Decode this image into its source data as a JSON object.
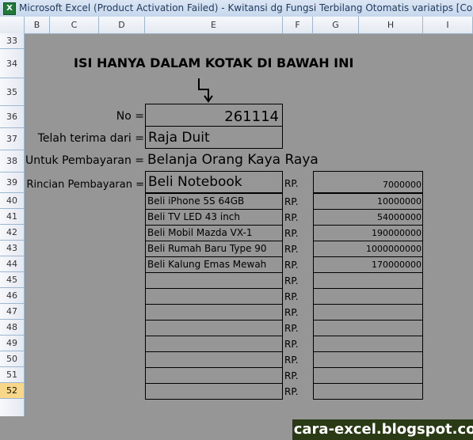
{
  "window": {
    "title": "Microsoft Excel (Product Activation Failed) - Kwitansi dg Fungsi Terbilang Otomatis variatips  [Compatibility",
    "app_icon": "excel-icon"
  },
  "columns": [
    "B",
    "C",
    "D",
    "E",
    "F",
    "G",
    "H",
    "I"
  ],
  "rows": [
    "33",
    "34",
    "35",
    "36",
    "37",
    "38",
    "39",
    "40",
    "41",
    "42",
    "43",
    "44",
    "45",
    "46",
    "47",
    "48",
    "49",
    "50",
    "51",
    "52"
  ],
  "active_row": "52",
  "form": {
    "heading": "ISI HANYA DALAM KOTAK DI BAWAH INI",
    "no_label": "No =",
    "no_value": "261114",
    "received_label": "Telah terima dari =",
    "received_value": "Raja Duit",
    "purpose_label": "Untuk Pembayaran =",
    "purpose_value": "Belanja Orang Kaya Raya",
    "details_label": "Rincian Pembayaran =",
    "details_title": "Beli Notebook",
    "currency": "RP.",
    "first_amount": "7000000",
    "items": [
      {
        "name": "Beli iPhone 5S 64GB",
        "amount": "10000000"
      },
      {
        "name": "Beli TV LED 43 inch",
        "amount": "54000000"
      },
      {
        "name": "Beli Mobil Mazda VX-1",
        "amount": "190000000"
      },
      {
        "name": "Beli Rumah Baru Type 90",
        "amount": "1000000000"
      },
      {
        "name": "Beli Kalung Emas Mewah",
        "amount": "170000000"
      },
      {
        "name": "",
        "amount": ""
      },
      {
        "name": "",
        "amount": ""
      },
      {
        "name": "",
        "amount": ""
      },
      {
        "name": "",
        "amount": ""
      },
      {
        "name": "",
        "amount": ""
      },
      {
        "name": "",
        "amount": ""
      },
      {
        "name": "",
        "amount": ""
      },
      {
        "name": "",
        "amount": ""
      }
    ]
  },
  "watermark": "cara-excel.blogspot.com"
}
